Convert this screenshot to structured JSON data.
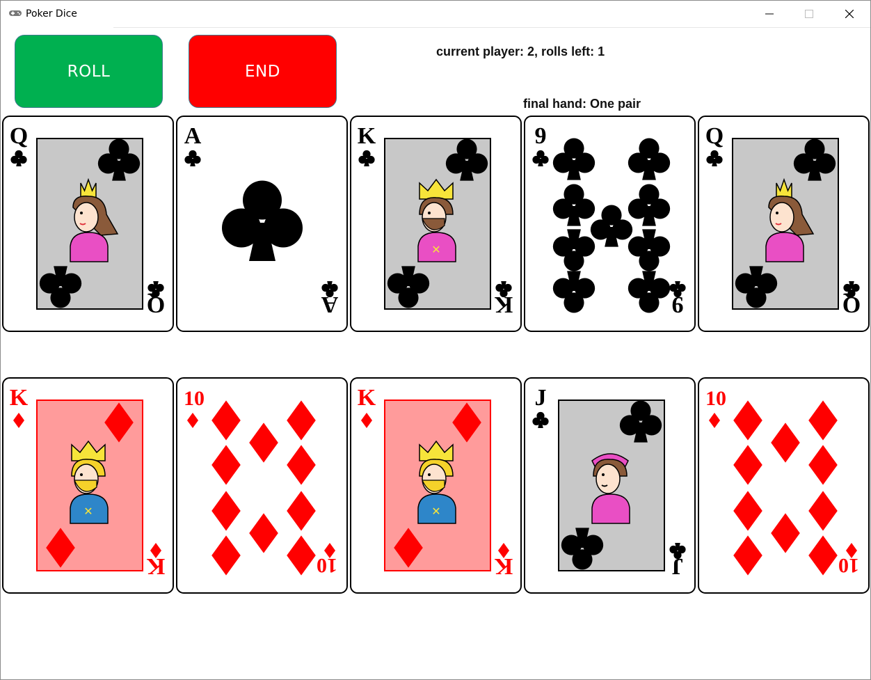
{
  "window": {
    "title": "Poker Dice",
    "icon": "gamepad-icon",
    "controls": [
      "minimize-icon",
      "maximize-icon",
      "close-icon"
    ]
  },
  "controls": {
    "roll_label": "ROLL",
    "end_label": "END",
    "roll_color": "#00b050",
    "end_color": "#ff0000"
  },
  "status": {
    "text": "current player: 2, rolls left: 1",
    "final_hand": "final hand: One pair"
  },
  "colors": {
    "clubs": "#000000",
    "diamonds": "#ff0000",
    "face_panel_black": "#c8c8c8",
    "face_panel_red": "#ff9b9b"
  },
  "hands": [
    {
      "row": 1,
      "cards": [
        {
          "rank": "Q",
          "suit": "clubs"
        },
        {
          "rank": "A",
          "suit": "clubs"
        },
        {
          "rank": "K",
          "suit": "clubs"
        },
        {
          "rank": "9",
          "suit": "clubs"
        },
        {
          "rank": "Q",
          "suit": "clubs"
        }
      ]
    },
    {
      "row": 2,
      "cards": [
        {
          "rank": "K",
          "suit": "diamonds"
        },
        {
          "rank": "10",
          "suit": "diamonds"
        },
        {
          "rank": "K",
          "suit": "diamonds"
        },
        {
          "rank": "J",
          "suit": "clubs"
        },
        {
          "rank": "10",
          "suit": "diamonds"
        }
      ]
    }
  ]
}
